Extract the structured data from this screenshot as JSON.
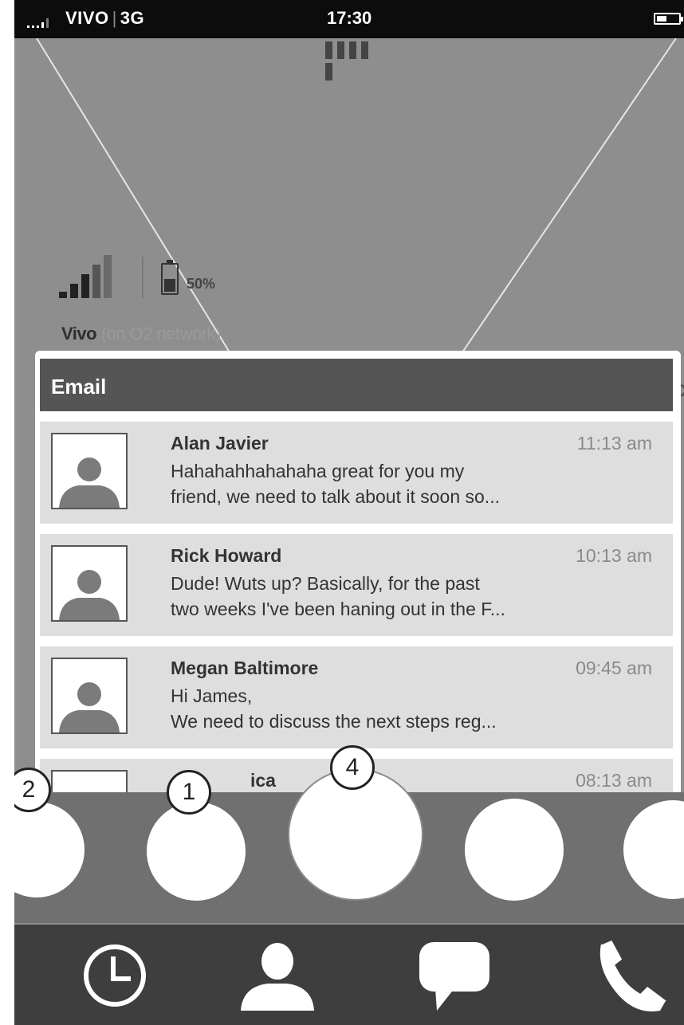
{
  "status_bar": {
    "carrier": "VIVO",
    "network_type": "3G",
    "time": "17:30"
  },
  "signal_info": {
    "battery_percent": "50%",
    "carrier_name": "Vivo",
    "network_note": "(on O2 network)"
  },
  "email_widget": {
    "title": "Email",
    "emails": [
      {
        "sender": "Alan Javier",
        "time": "11:13 am",
        "preview_line1": "Hahahahhahahaha great for you my",
        "preview_line2": "friend, we need to talk about it soon so..."
      },
      {
        "sender": "Rick Howard",
        "time": "10:13 am",
        "preview_line1": "Dude! Wuts up? Basically, for the past",
        "preview_line2": "two weeks I've been haning out in the F..."
      },
      {
        "sender": "Megan Baltimore",
        "time": "09:45 am",
        "preview_line1": "Hi James,",
        "preview_line2": "We need to discuss the next steps reg..."
      },
      {
        "sender": "ica",
        "time": "08:13 am"
      }
    ]
  },
  "dock": {
    "badges": [
      "2",
      "1",
      "4"
    ]
  },
  "tab_bar": {
    "icons": [
      "clock-icon",
      "contact-icon",
      "chat-bubble-icon",
      "phone-icon"
    ]
  },
  "colors": {
    "background": "#8e8e8e",
    "status_bar": "#0c0c0c",
    "email_header": "#555555",
    "email_row": "#dedede",
    "dock": "#707070",
    "tab_bar": "#3e3e3e"
  }
}
